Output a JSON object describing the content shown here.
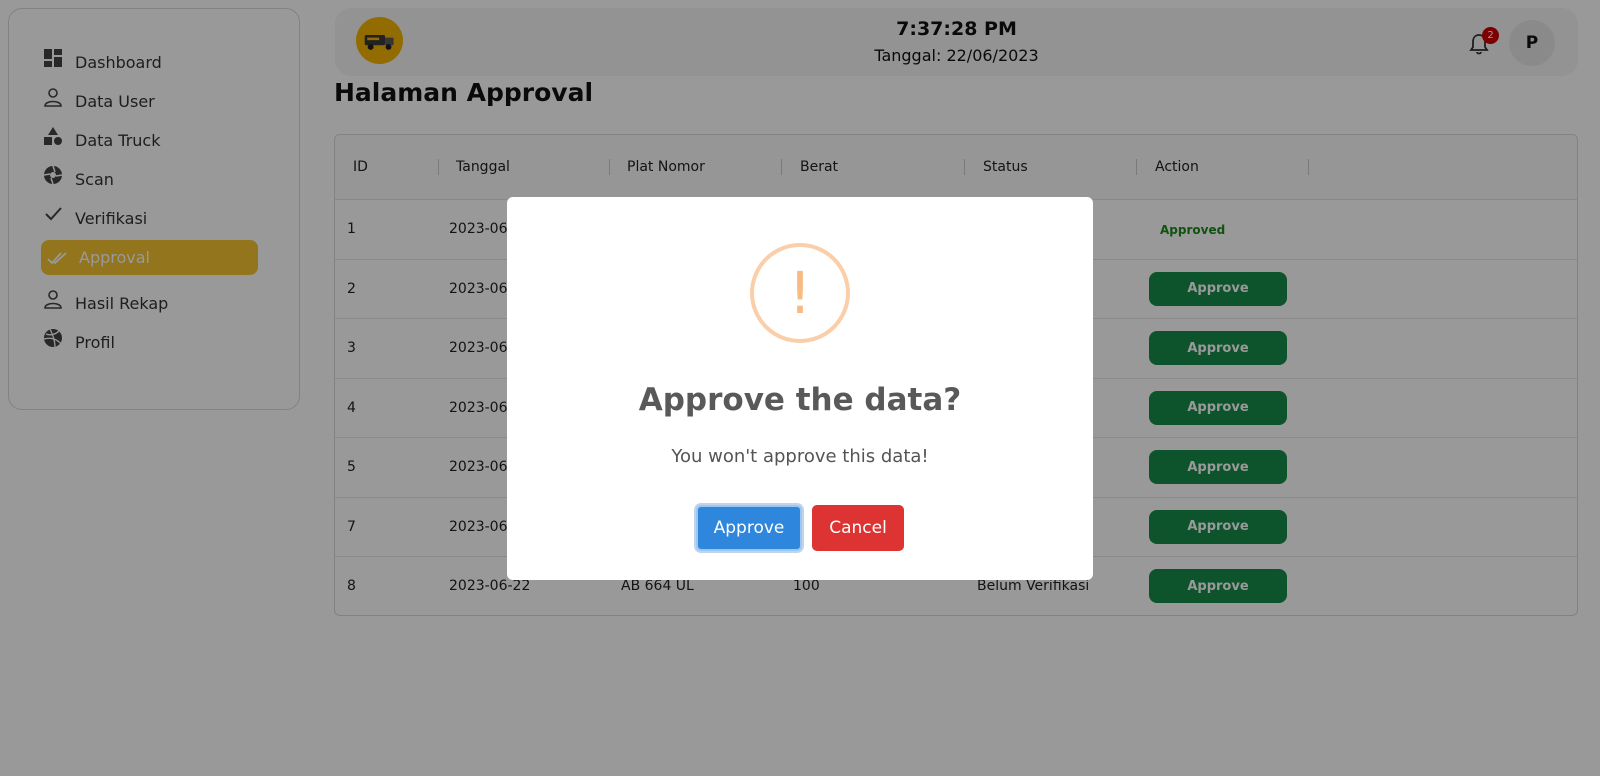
{
  "sidebar": {
    "items": [
      {
        "label": "Dashboard",
        "icon": "dashboard-icon"
      },
      {
        "label": "Data User",
        "icon": "user-icon"
      },
      {
        "label": "Data Truck",
        "icon": "shapes-icon"
      },
      {
        "label": "Scan",
        "icon": "aperture-icon"
      },
      {
        "label": "Verifikasi",
        "icon": "check-icon"
      },
      {
        "label": "Approval",
        "icon": "double-check-icon",
        "active": true
      },
      {
        "label": "Hasil Rekap",
        "icon": "user-icon"
      },
      {
        "label": "Profil",
        "icon": "dribbble-icon"
      }
    ]
  },
  "header": {
    "time": "7:37:28 PM",
    "date": "Tanggal: 22/06/2023",
    "notification_count": "2",
    "avatar_initial": "P"
  },
  "page": {
    "title": "Halaman Approval"
  },
  "table": {
    "columns": [
      "ID",
      "Tanggal",
      "Plat Nomor",
      "Berat",
      "Status",
      "Action"
    ],
    "rows": [
      {
        "id": "1",
        "tanggal": "2023-06-",
        "plat": "",
        "berat": "",
        "status": "",
        "action": "Approved"
      },
      {
        "id": "2",
        "tanggal": "2023-06-",
        "plat": "",
        "berat": "",
        "status": "",
        "action": "Approve"
      },
      {
        "id": "3",
        "tanggal": "2023-06-",
        "plat": "",
        "berat": "",
        "status": "",
        "action": "Approve"
      },
      {
        "id": "4",
        "tanggal": "2023-06-",
        "plat": "",
        "berat": "",
        "status": "",
        "action": "Approve"
      },
      {
        "id": "5",
        "tanggal": "2023-06-",
        "plat": "",
        "berat": "",
        "status": "",
        "action": "Approve"
      },
      {
        "id": "7",
        "tanggal": "2023-06-",
        "plat": "",
        "berat": "",
        "status": "",
        "action": "Approve"
      },
      {
        "id": "8",
        "tanggal": "2023-06-22",
        "plat": "AB 664 UL",
        "berat": "100",
        "status": "Belum Verifikasi",
        "action": "Approve"
      }
    ]
  },
  "modal": {
    "icon": "!",
    "title": "Approve the data?",
    "text": "You won't approve this data!",
    "confirm_label": "Approve",
    "cancel_label": "Cancel"
  },
  "colors": {
    "accent": "#f4c430",
    "approve_green": "#178c4a",
    "confirm_blue": "#2f86dd",
    "cancel_red": "#dd3333",
    "warning": "#f8bb86"
  }
}
